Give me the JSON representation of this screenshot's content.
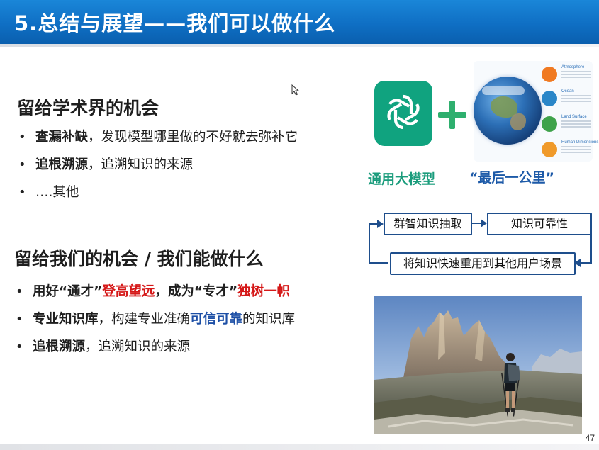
{
  "header": {
    "title": "5.总结与展望——我们可以做什么"
  },
  "section1": {
    "heading": "留给学术界的机会",
    "items": [
      {
        "bold": "查漏补缺",
        "rest": "，发现模型哪里做的不好就去弥补它"
      },
      {
        "bold": "追根溯源",
        "rest": "，追溯知识的来源"
      },
      {
        "bold": "",
        "rest": "….其他"
      }
    ]
  },
  "section2": {
    "heading": "留给我们的机会 / 我们能做什么",
    "item1": {
      "p1": "用好“通才”",
      "p2": "登高望远",
      "p3": "，成为“专才”",
      "p4": "独树一帜"
    },
    "item2": {
      "p1": "专业知识库",
      "p2": "，构建专业准确",
      "p3": "可信可靠",
      "p4": "的知识库"
    },
    "item3": {
      "p1": "追根溯源",
      "p2": "，追溯知识的来源"
    }
  },
  "captions": {
    "left": "通用大模型",
    "right": "“最后一公里”"
  },
  "earth_panel": {
    "spheres": [
      {
        "label": "Atmosphere",
        "color": "#f07a22"
      },
      {
        "label": "Ocean",
        "color": "#2a86c8"
      },
      {
        "label": "Land Surface",
        "color": "#3ea24a"
      },
      {
        "label": "Human Dimensions",
        "color": "#f09a2a"
      }
    ]
  },
  "flow": {
    "box1": "群智知识抽取",
    "box2": "知识可靠性",
    "box3": "将知识快速重用到其他用户场景"
  },
  "colors": {
    "header_blue": "#0f6fc4",
    "highlight_red": "#d51818",
    "highlight_blue": "#1d4fa6",
    "openai_green": "#10a37f",
    "flow_blue": "#1e4e8c"
  },
  "icons": {
    "logo": "openai-logo-icon",
    "plus": "plus-icon",
    "cursor": "mouse-cursor-icon"
  },
  "page_number": "47"
}
